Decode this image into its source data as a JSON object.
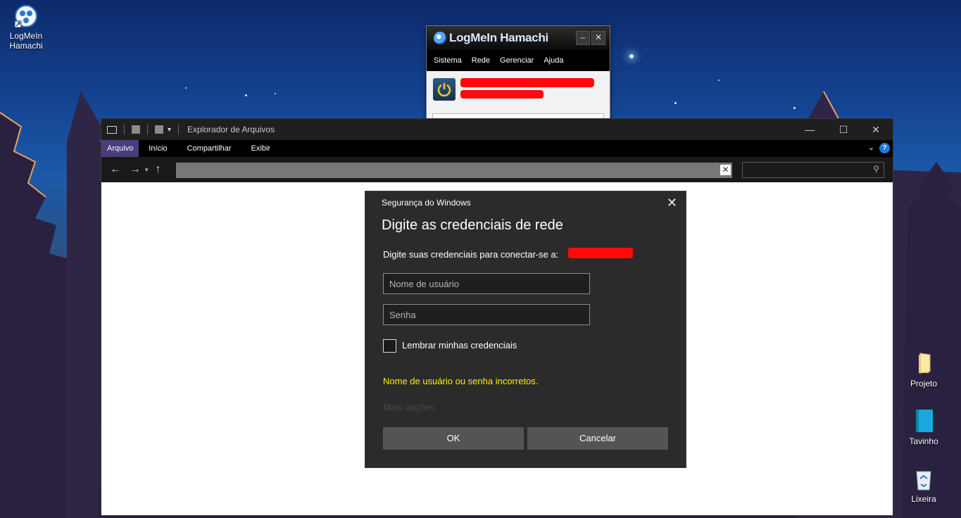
{
  "desktop": {
    "icons": [
      {
        "label": "LogMeIn\nHamachi",
        "icon": "hamachi-icon"
      },
      {
        "label": "Projeto",
        "icon": "folder-icon"
      },
      {
        "label": "Tavinho",
        "icon": "notebook-icon"
      },
      {
        "label": "Lixeira",
        "icon": "recycle-bin-icon"
      }
    ]
  },
  "hamachi": {
    "title": "LogMeIn Hamachi",
    "menu": [
      "Sistema",
      "Rede",
      "Gerenciar",
      "Ajuda"
    ],
    "minimize": "–",
    "close": "✕"
  },
  "explorer": {
    "title": "Explorador de Arquivos",
    "tabs": [
      "Arquivo",
      "Início",
      "Compartilhar",
      "Exibir"
    ],
    "help": "?",
    "window_controls": {
      "minimize": "—",
      "maximize": "☐",
      "close": "✕"
    }
  },
  "dialog": {
    "caption": "Segurança do Windows",
    "heading": "Digite as credenciais de rede",
    "message": "Digite suas credenciais para conectar-se a:",
    "username_placeholder": "Nome de usuário",
    "password_placeholder": "Senha",
    "remember_label": "Lembrar minhas credenciais",
    "remember_checked": false,
    "error": "Nome de usuário ou senha incorretos.",
    "more_options": "Mais opções",
    "ok_label": "OK",
    "cancel_label": "Cancelar",
    "close": "✕"
  },
  "colors": {
    "accent_tab": "#4a3d7c",
    "error_text": "#ffee00",
    "redaction": "#ff0a0a"
  }
}
